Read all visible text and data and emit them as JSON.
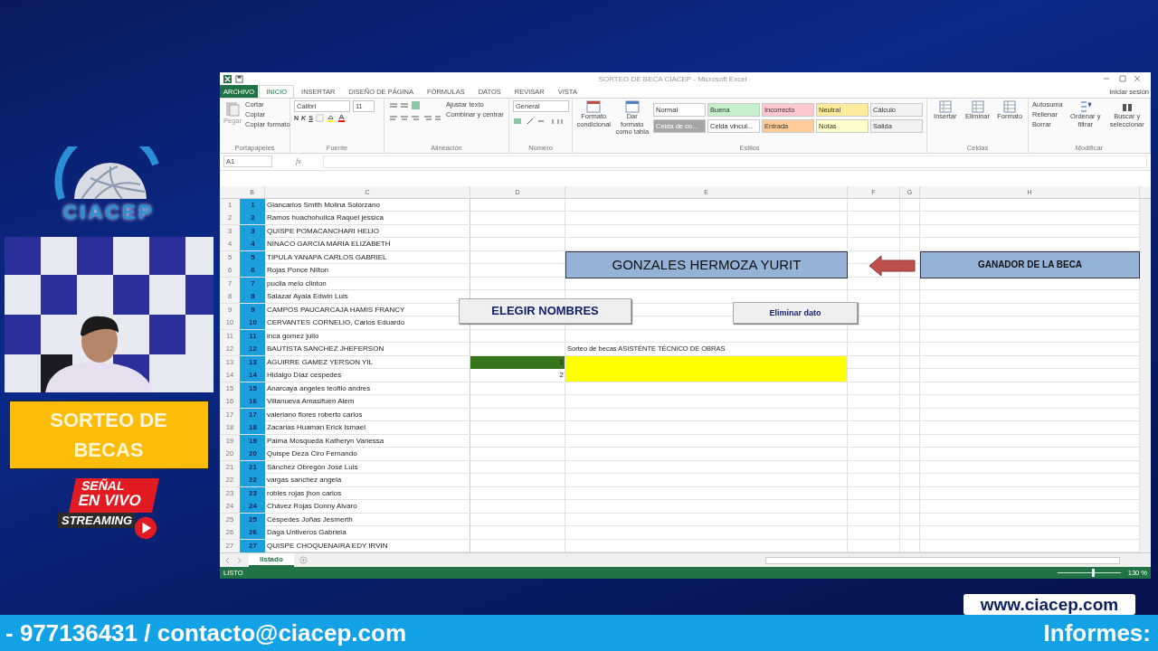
{
  "brand": {
    "name": "CIACEP"
  },
  "banner": {
    "title": "SORTEO DE BECAS"
  },
  "live_badge": {
    "line_1": "SEÑAL",
    "line_2": "EN VIVO",
    "line_3": "STREAMING"
  },
  "website": "www.ciacep.com",
  "footer": {
    "contact": "- 977136431 / contacto@ciacep.com",
    "label": "Informes:"
  },
  "excel": {
    "title": "SORTEO DE BECA CIACEP - Microsoft Excel",
    "sign_in": "Iniciar sesión",
    "tabs": [
      {
        "label": "ARCHIVO",
        "kind": "file",
        "selected": false
      },
      {
        "label": "INICIO",
        "kind": "tab",
        "selected": true
      },
      {
        "label": "INSERTAR",
        "kind": "tab",
        "selected": false
      },
      {
        "label": "DISEÑO DE PÁGINA",
        "kind": "tab",
        "selected": false
      },
      {
        "label": "FÓRMULAS",
        "kind": "tab",
        "selected": false
      },
      {
        "label": "DATOS",
        "kind": "tab",
        "selected": false
      },
      {
        "label": "REVISAR",
        "kind": "tab",
        "selected": false
      },
      {
        "label": "VISTA",
        "kind": "tab",
        "selected": false
      }
    ],
    "clipboard": {
      "paste": "Pegar",
      "items": [
        "Cortar",
        "Copiar",
        "Copiar formato"
      ],
      "label": "Portapapeles"
    },
    "font": {
      "family": "Calibri",
      "size": "11",
      "styles": [
        "N",
        "K",
        "S"
      ],
      "label": "Fuente"
    },
    "alignment": {
      "items": [
        "Ajustar texto",
        "Combinar y centrar"
      ],
      "label": "Alineación"
    },
    "number": {
      "format": "General",
      "label": "Número"
    },
    "styles": {
      "buttons": [
        "Formato condicional",
        "Dar formato como tabla"
      ],
      "label": "Estilos",
      "cells": [
        {
          "text": "Normal",
          "color": "#ffffff"
        },
        {
          "text": "Buena",
          "color": "#c6efce"
        },
        {
          "text": "Incorrecto",
          "color": "#ffc7ce"
        },
        {
          "text": "Neutral",
          "color": "#ffeb9c"
        },
        {
          "text": "Cálculo",
          "color": "#f2f2f2"
        },
        {
          "text": "Celda de co...",
          "color": "#a5a5a5"
        },
        {
          "text": "Celda vincul...",
          "color": "#fdfdfd"
        },
        {
          "text": "Entrada",
          "color": "#ffcc99"
        },
        {
          "text": "Notas",
          "color": "#ffffcc"
        },
        {
          "text": "Salida",
          "color": "#f2f2f2"
        }
      ]
    },
    "cells_group": {
      "buttons": [
        "Insertar",
        "Eliminar",
        "Formato"
      ],
      "label": "Celdas"
    },
    "editing": {
      "items": [
        "Autosuma",
        "Rellenar",
        "Borrar"
      ],
      "buttons": [
        "Ordenar y filtrar",
        "Buscar y seleccionar"
      ],
      "label": "Modificar"
    },
    "name_box": "A1",
    "fx": "fx",
    "columns": [
      "B",
      "C",
      "D",
      "E",
      "F",
      "G",
      "H"
    ],
    "rows": [
      {
        "row": "1",
        "num": "1",
        "name": "Giancarlos Smith Molina Solórzano"
      },
      {
        "row": "2",
        "num": "2",
        "name": "Ramos huachohuilca Raquel jessica"
      },
      {
        "row": "3",
        "num": "3",
        "name": "QUISPE POMACANCHARI HELIO"
      },
      {
        "row": "4",
        "num": "4",
        "name": "NINACO GARCIA MARIA ELIZABETH"
      },
      {
        "row": "5",
        "num": "5",
        "name": "TIPULA YANAPA CARLOS GABRIEL"
      },
      {
        "row": "6",
        "num": "6",
        "name": "Rojas Ponce Nilton"
      },
      {
        "row": "7",
        "num": "7",
        "name": "puclla melo clinton"
      },
      {
        "row": "8",
        "num": "8",
        "name": "Salazar Ayala Edwin Luis"
      },
      {
        "row": "9",
        "num": "9",
        "name": "CAMPOS PAUCARCAJA HAMIS FRANCY"
      },
      {
        "row": "10",
        "num": "10",
        "name": "CERVANTES CORNELIO, Carlos Eduardo"
      },
      {
        "row": "11",
        "num": "11",
        "name": "inca gomez julio"
      },
      {
        "row": "12",
        "num": "12",
        "name": "BAUTISTA SANCHEZ JHEFERSON",
        "e": "Sorteo de becas ASISTÉNTE TÉCNICO DE OBRAS"
      },
      {
        "row": "13",
        "num": "13",
        "name": "AGUIRRE GAMEZ YERSON YIL",
        "d": "1",
        "d_fill": {
          "color": "#38761d"
        },
        "e_fill": {
          "color": "#ffff00"
        }
      },
      {
        "row": "14",
        "num": "14",
        "name": "Hidalgo Díaz cespedes",
        "d": "2",
        "e_fill": {
          "color": "#ffff00"
        }
      },
      {
        "row": "15",
        "num": "15",
        "name": "Anarcaya angeles teofilo andres"
      },
      {
        "row": "16",
        "num": "16",
        "name": "Villanueva Amasifuen Alem"
      },
      {
        "row": "17",
        "num": "17",
        "name": "valeriano flores roberto carlos"
      },
      {
        "row": "18",
        "num": "18",
        "name": "Zacarias Huaman Erick Ismael"
      },
      {
        "row": "19",
        "num": "19",
        "name": "Paima Mosqueda Katheryn Vanessa"
      },
      {
        "row": "20",
        "num": "20",
        "name": "Quispe Deza Ciro Fernando"
      },
      {
        "row": "21",
        "num": "21",
        "name": "Sánchez Obregón José Luis"
      },
      {
        "row": "22",
        "num": "22",
        "name": "vargas sanchez angela"
      },
      {
        "row": "23",
        "num": "23",
        "name": "robles rojas jhon carlos"
      },
      {
        "row": "24",
        "num": "24",
        "name": "Chávez Rojas Donny Alvaro"
      },
      {
        "row": "25",
        "num": "25",
        "name": "Céspedes Joñas Jesmerth"
      },
      {
        "row": "26",
        "num": "26",
        "name": "Daga Untiveros Gabriela"
      },
      {
        "row": "27",
        "num": "27",
        "name": "QUISPE CHOQUENAIRA EDY IRVIN"
      }
    ],
    "winner": "GONZALES HERMOZA YURIT",
    "winner_label": "GANADOR DE LA BECA",
    "buttons": [
      "ELEGIR NOMBRES",
      "Eliminar dato"
    ],
    "sheets": [
      {
        "label": "listado",
        "selected": true
      }
    ],
    "status": "LISTO",
    "zoom_slider": {
      "level": 0.55
    },
    "zoom": "130 %"
  }
}
